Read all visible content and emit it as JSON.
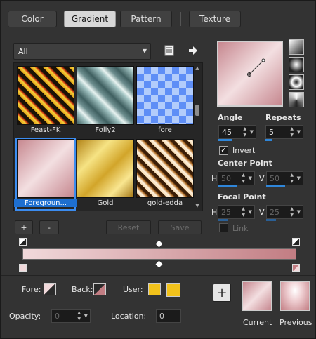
{
  "tabs": [
    {
      "label": "Color"
    },
    {
      "label": "Gradient"
    },
    {
      "label": "Pattern"
    },
    {
      "label": "Texture"
    }
  ],
  "category": {
    "selected": "All"
  },
  "gallery": [
    {
      "label": "Feast-FK"
    },
    {
      "label": "Folly2"
    },
    {
      "label": "fore"
    },
    {
      "label": "Foregroun..."
    },
    {
      "label": "Gold"
    },
    {
      "label": "gold-edda"
    }
  ],
  "buttons": {
    "add": "+",
    "remove": "-",
    "reset": "Reset",
    "save": "Save"
  },
  "settings": {
    "angle_label": "Angle",
    "angle_value": "45",
    "repeats_label": "Repeats",
    "repeats_value": "5",
    "invert_label": "Invert",
    "invert_checked": "✓",
    "center_point_label": "Center Point",
    "center_h_label": "H",
    "center_h_value": "50",
    "center_v_label": "V",
    "center_v_value": "50",
    "focal_point_label": "Focal Point",
    "focal_h_label": "H",
    "focal_h_value": "25",
    "focal_v_label": "V",
    "focal_v_value": "25",
    "link_label": "Link"
  },
  "footer": {
    "fore_label": "Fore:",
    "back_label": "Back:",
    "user_label": "User:",
    "opacity_label": "Opacity:",
    "opacity_value": "0",
    "location_label": "Location:",
    "location_value": "0",
    "add_symbol": "+",
    "current_label": "Current",
    "previous_label": "Previous"
  },
  "colors": {
    "accent": "#2f86d9",
    "gradient_start": "#f1d9db",
    "gradient_end": "#c27d83",
    "user_color": "#f2c21b"
  }
}
